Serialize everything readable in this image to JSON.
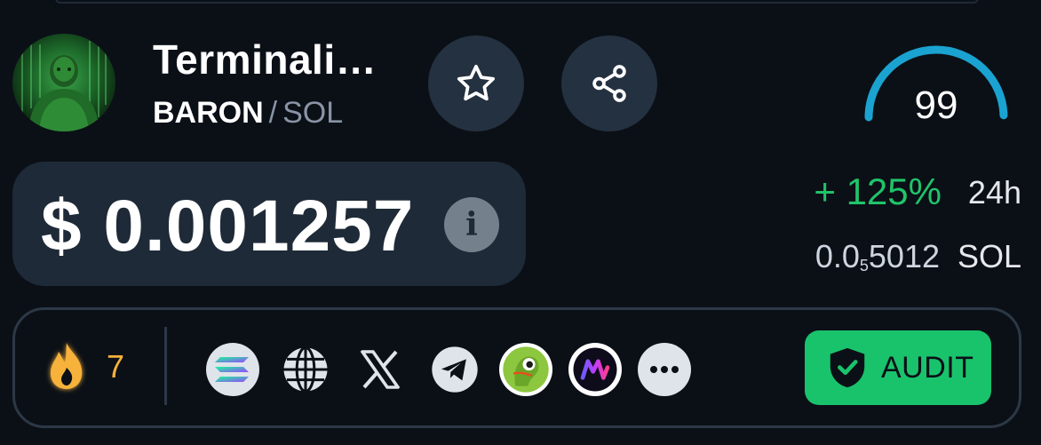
{
  "token": {
    "name": "Terminali…",
    "symbol": "BARON",
    "separator": "/",
    "quote": "SOL",
    "avatar_icon": "hulk-avatar"
  },
  "actions": {
    "favorite_icon": "star-icon",
    "share_icon": "share-icon"
  },
  "score": {
    "value": "99",
    "percent": 99,
    "color": "#1aa3d1"
  },
  "price": {
    "usd": "$ 0.001257",
    "info_label": "i",
    "change": "+ 125%",
    "period": "24h",
    "sol_prefix": "0.0",
    "sol_zeros": "5",
    "sol_digits": "5012",
    "sol_unit": "SOL"
  },
  "socials": {
    "hot_count": "7",
    "links": [
      {
        "icon": "solana-icon"
      },
      {
        "icon": "globe-icon"
      },
      {
        "icon": "x-icon"
      },
      {
        "icon": "telegram-icon"
      },
      {
        "icon": "coingecko-icon"
      },
      {
        "icon": "mobula-icon"
      },
      {
        "icon": "more-icon"
      }
    ],
    "audit_label": "AUDIT"
  },
  "colors": {
    "background": "#0b1017",
    "panel": "#1e2a37",
    "positive": "#20c46a",
    "audit": "#19c36c",
    "fire": "#f7b23b"
  }
}
